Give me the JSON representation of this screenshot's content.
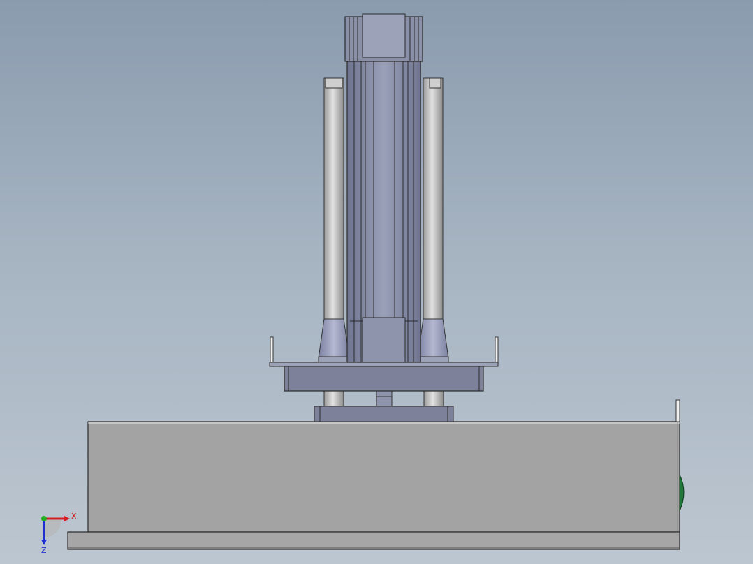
{
  "viewport": {
    "background_top": "#8a9bae",
    "background_bottom": "#bcc6d0"
  },
  "model": {
    "body_color": "#a3a3a3",
    "metal_color": "#8a90a8",
    "rod_color": "#c8c8c8",
    "accent_color": "#1f7a3a"
  },
  "triad": {
    "x_label": "X",
    "z_label": "Z",
    "x_color": "#d42020",
    "y_color": "#20b020",
    "z_color": "#2030d0"
  }
}
